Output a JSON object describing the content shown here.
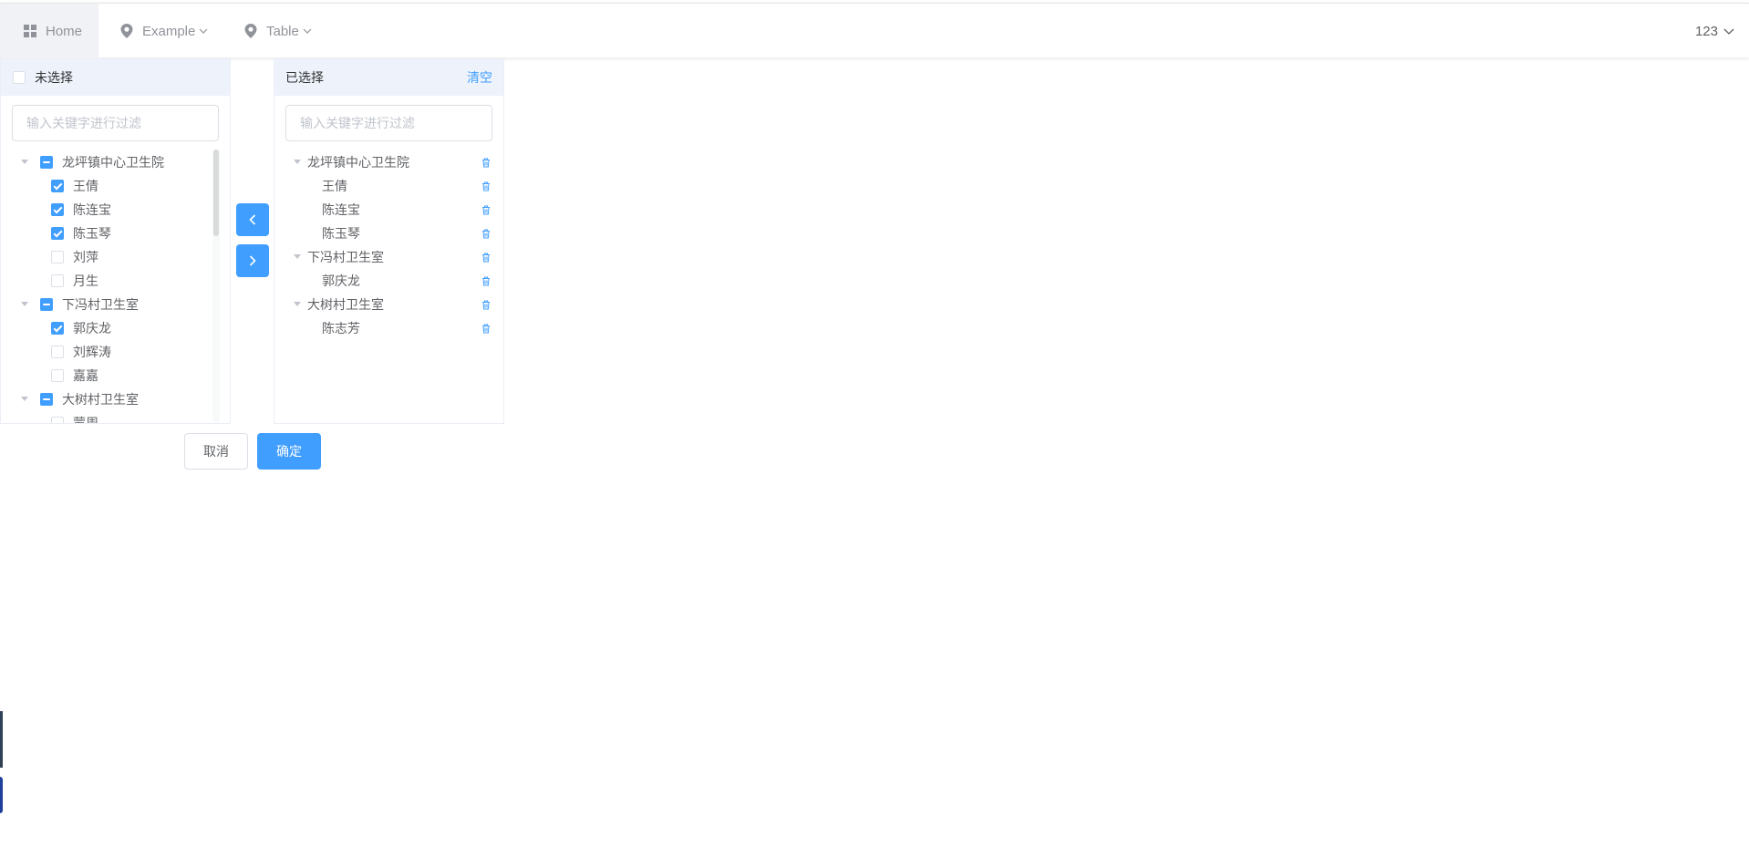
{
  "nav": {
    "home": "Home",
    "example": "Example",
    "table": "Table",
    "user": "123"
  },
  "left_panel": {
    "header": "未选择",
    "filter_placeholder": "输入关键字进行过滤",
    "nodes": [
      {
        "label": "龙坪镇中心卫生院",
        "level": 0,
        "state": "indeterminate"
      },
      {
        "label": "王倩",
        "level": 1,
        "state": "checked"
      },
      {
        "label": "陈连宝",
        "level": 1,
        "state": "checked"
      },
      {
        "label": "陈玉琴",
        "level": 1,
        "state": "checked"
      },
      {
        "label": "刘萍",
        "level": 1,
        "state": "unchecked"
      },
      {
        "label": "月生",
        "level": 1,
        "state": "unchecked"
      },
      {
        "label": "下冯村卫生室",
        "level": 0,
        "state": "indeterminate"
      },
      {
        "label": "郭庆龙",
        "level": 1,
        "state": "checked"
      },
      {
        "label": "刘辉涛",
        "level": 1,
        "state": "unchecked"
      },
      {
        "label": "嘉嘉",
        "level": 1,
        "state": "unchecked"
      },
      {
        "label": "大树村卫生室",
        "level": 0,
        "state": "indeterminate"
      },
      {
        "label": "蒙周",
        "level": 1,
        "state": "unchecked"
      }
    ]
  },
  "right_panel": {
    "header": "已选择",
    "clear_label": "清空",
    "filter_placeholder": "输入关键字进行过滤",
    "nodes": [
      {
        "label": "龙坪镇中心卫生院",
        "level": 0
      },
      {
        "label": "王倩",
        "level": 1
      },
      {
        "label": "陈连宝",
        "level": 1
      },
      {
        "label": "陈玉琴",
        "level": 1
      },
      {
        "label": "下冯村卫生室",
        "level": 0
      },
      {
        "label": "郭庆龙",
        "level": 1
      },
      {
        "label": "大树村卫生室",
        "level": 0
      },
      {
        "label": "陈志芳",
        "level": 1
      }
    ]
  },
  "buttons": {
    "cancel": "取消",
    "confirm": "确定"
  },
  "colors": {
    "primary": "#409eff",
    "header_bg": "#eef3fb"
  }
}
